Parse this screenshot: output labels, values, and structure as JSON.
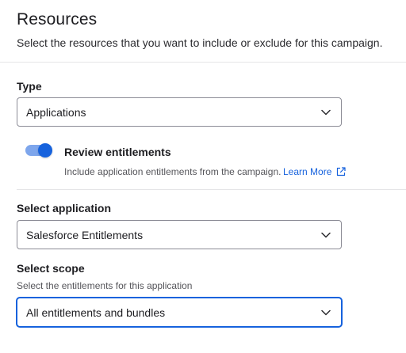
{
  "header": {
    "title": "Resources",
    "subtitle": "Select the resources that you want to include or exclude for this campaign."
  },
  "type_field": {
    "label": "Type",
    "value": "Applications",
    "icon": "chevron-down-icon"
  },
  "review_entitlements": {
    "label": "Review entitlements",
    "enabled": true,
    "description": "Include application entitlements from the campaign.",
    "learn_more": "Learn More",
    "learn_more_icon": "external-link-icon"
  },
  "application_field": {
    "label": "Select application",
    "value": "Salesforce Entitlements",
    "icon": "chevron-down-icon"
  },
  "scope_field": {
    "label": "Select scope",
    "helper": "Select the entitlements for this application",
    "value": "All entitlements and bundles",
    "icon": "chevron-down-icon"
  },
  "colors": {
    "accent": "#1662dd",
    "toggle_track": "#7ea6ec",
    "border": "#8c8c96",
    "divider": "#e5e5e7"
  }
}
